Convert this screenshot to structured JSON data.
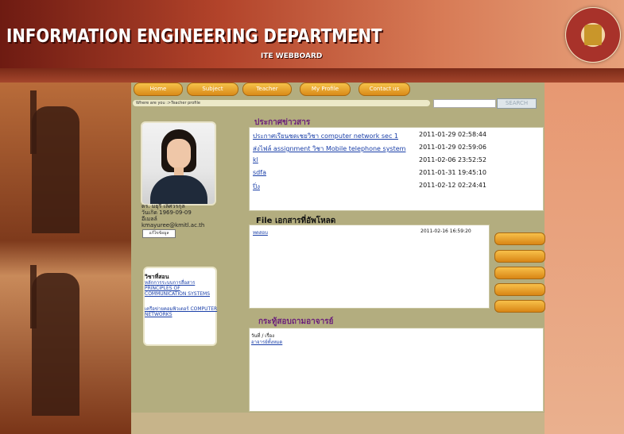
{
  "header": {
    "title": "INFORMATION ENGINEERING DEPARTMENT",
    "subtitle": "ITE WEBBOARD"
  },
  "nav": [
    {
      "label": "Home"
    },
    {
      "label": "Subject"
    },
    {
      "label": "Teacher"
    },
    {
      "label": "My Profile"
    },
    {
      "label": "Contact us"
    }
  ],
  "breadcrumb": "Where are you :>Teacher profile",
  "search": {
    "button": "SEARCH",
    "value": ""
  },
  "profile": {
    "name": "ดร. มยุรี เลิศวรกุล",
    "birth": "วันเกิด 1969-09-09",
    "email_label": "อีเมลล์",
    "email": "kmayuree@kmitl.ac.th",
    "edit_button": "แก้ไขข้อมูล"
  },
  "courses": {
    "title": "วิชาที่สอน",
    "items": [
      {
        "thai": "หลักการระบบการสื่อสาร",
        "english": "PRINCIPLES OF COMMUNICATION SYSTEMS"
      },
      {
        "thai": "เครือข่ายคอมพิวเตอร์",
        "english": "COMPUTER NETWORKS"
      }
    ]
  },
  "news": {
    "title": "ประกาศข่าวสาร",
    "items": [
      {
        "text": "ประกาศเรียนชดเชยวิชา computer network sec 1",
        "date": "2011-01-29 02:58:44"
      },
      {
        "text": "ส่งไฟล์ assignment วิชา Mobile telephone system",
        "date": "2011-01-29 02:59:06"
      },
      {
        "text": "kl",
        "date": "2011-02-06 23:52:52"
      },
      {
        "text": "sdfa",
        "date": "2011-01-31 19:45:10"
      },
      {
        "text": "ปิ่ง",
        "date": "2011-02-12 02:24:41"
      }
    ]
  },
  "files": {
    "title": "File เอกสารที่อัพโหลด",
    "items": [
      {
        "name": "ทดสอบ",
        "date": "2011-02-16 16:59:20"
      }
    ]
  },
  "board": {
    "title": "กระทู้สอบถามอาจารย์",
    "header": "วันที่ / เรื่อง",
    "link": "อาจารย์ทั้งหมด"
  }
}
